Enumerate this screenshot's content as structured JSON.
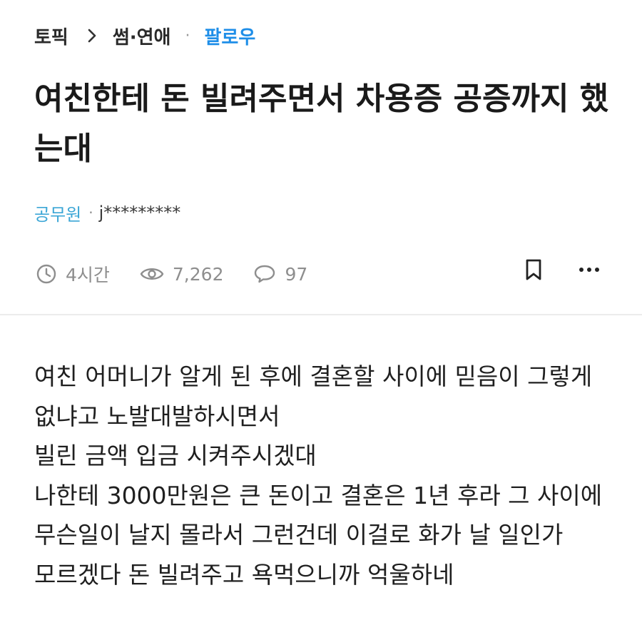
{
  "breadcrumb": {
    "topic": "토픽",
    "category": "썸·연애",
    "dot": "·",
    "follow": "팔로우"
  },
  "post": {
    "title": "여친한테 돈 빌려주면서 차용증 공증까지 했는대",
    "author_company": "공무원",
    "author_separator": "·",
    "author_nickname": "j*********",
    "time": "4시간",
    "views": "7,262",
    "comments": "97",
    "body": [
      "여친 어머니가 알게 된 후에 결혼할 사이에 믿음이 그렇게 없냐고 노발대발하시면서",
      "빌린 금액 입금 시켜주시겠대",
      "나한테 3000만원은 큰 돈이고 결혼은 1년 후라 그 사이에 무슨일이 날지 몰라서 그런건데 이걸로 화가 날 일인가 모르겠다 돈 빌려주고 욕먹으니까 억울하네"
    ]
  },
  "icons": {
    "chevron": "chevron-right-icon",
    "clock": "clock-icon",
    "eye": "eye-icon",
    "comment": "comment-bubble-icon",
    "bookmark": "bookmark-icon",
    "more": "more-horizontal-icon"
  },
  "colors": {
    "follow": "#1e8ee8",
    "company": "#3ba6d6",
    "meta": "#8e8e8e"
  }
}
